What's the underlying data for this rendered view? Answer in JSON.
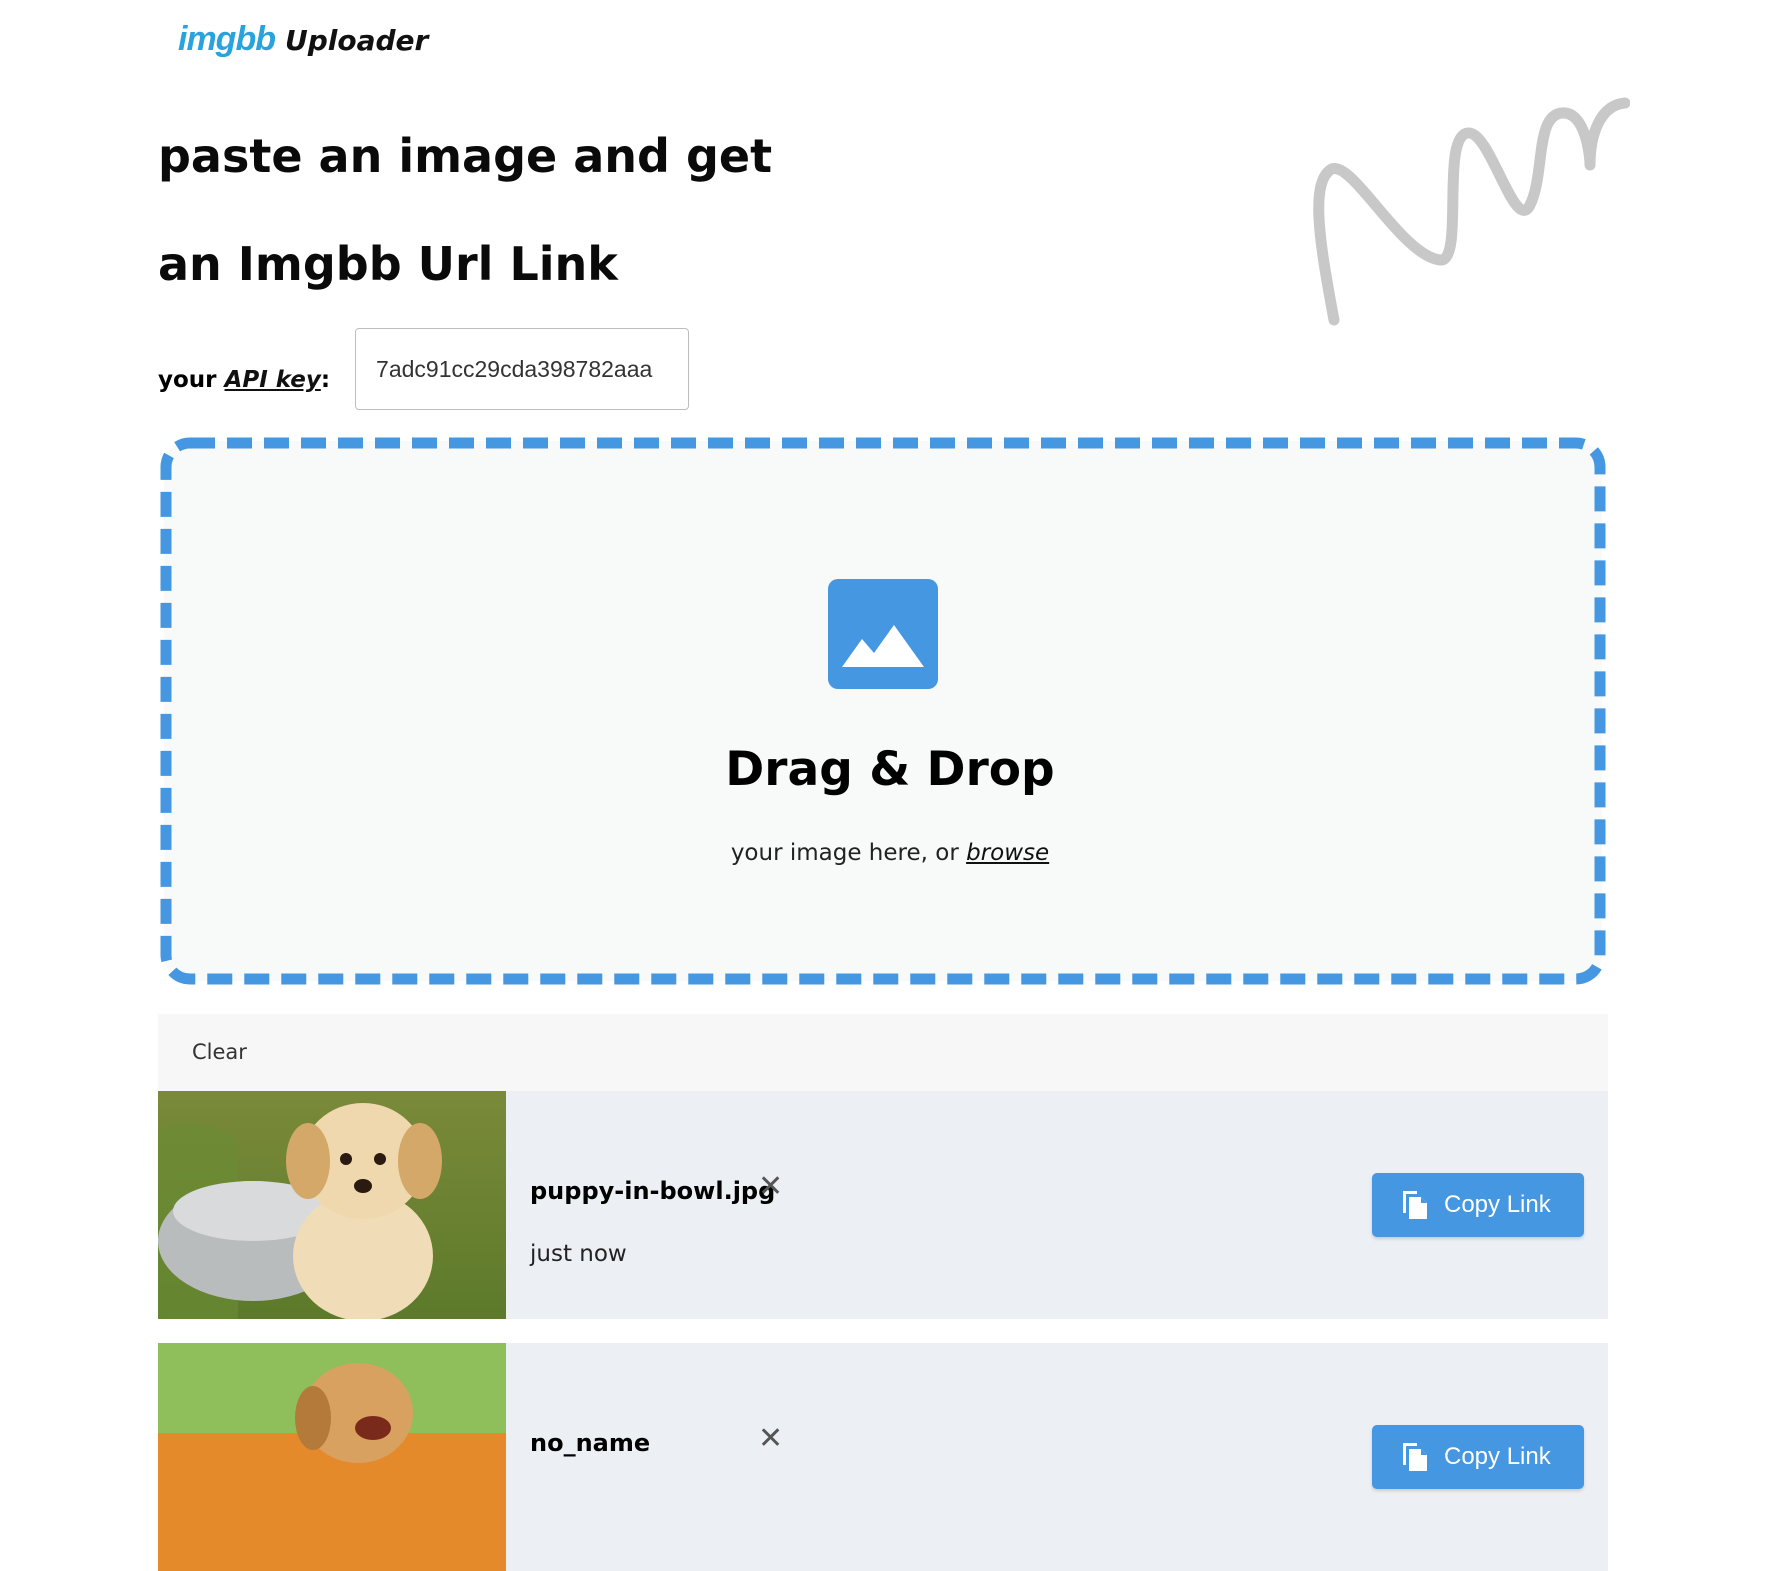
{
  "header": {
    "brand": "imgbb",
    "title": "Uploader"
  },
  "hero": {
    "line1": "paste an image and get",
    "line2": "an Imgbb Url Link"
  },
  "api": {
    "label_prefix": "your ",
    "label_link": "API key",
    "label_suffix": ":",
    "value": "7adc91cc29cda398782aaa"
  },
  "dropzone": {
    "title": "Drag & Drop",
    "subtitle": "your image here, or ",
    "browse": "browse",
    "accent": "#4497e0"
  },
  "toolbar": {
    "clear_label": "Clear"
  },
  "uploads": [
    {
      "name": "puppy-in-bowl.jpg",
      "time": "just now",
      "copy_label": "Copy Link"
    },
    {
      "name": "no_name",
      "time": "",
      "copy_label": "Copy Link"
    }
  ]
}
